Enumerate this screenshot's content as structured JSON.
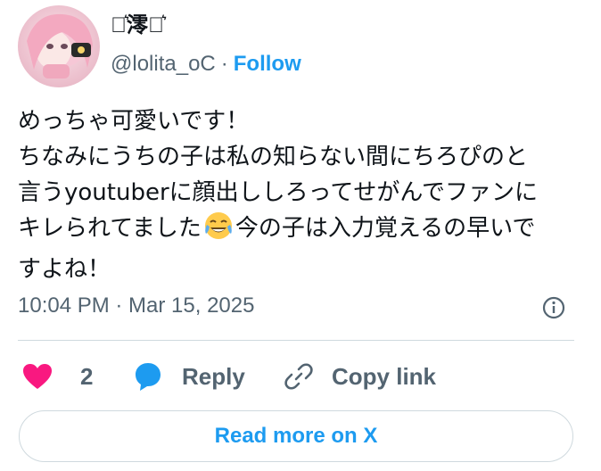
{
  "author": {
    "display_name": "⋆͛澪⋆͛",
    "handle": "@lolita_oC",
    "separator": "·",
    "follow_label": "Follow"
  },
  "tweet": {
    "lines": [
      "めっちゃ可愛いです！",
      "ちなみにうちの子は私の知らない間にちろぴのと",
      "言うyoutuberに顔出ししろってせがんでファンに",
      "キレられてました",
      "今の子は入力覚えるの早いで",
      "すよね！"
    ],
    "emoji": "face-with-tears-of-joy-icon",
    "timestamp": "10:04 PM · Mar 15, 2025"
  },
  "actions": {
    "like_count": "2",
    "reply_label": "Reply",
    "copy_label": "Copy link"
  },
  "footer": {
    "read_more_label": "Read more on X"
  },
  "colors": {
    "accent": "#1d9bf0",
    "like": "#f91880",
    "muted": "#536471"
  }
}
